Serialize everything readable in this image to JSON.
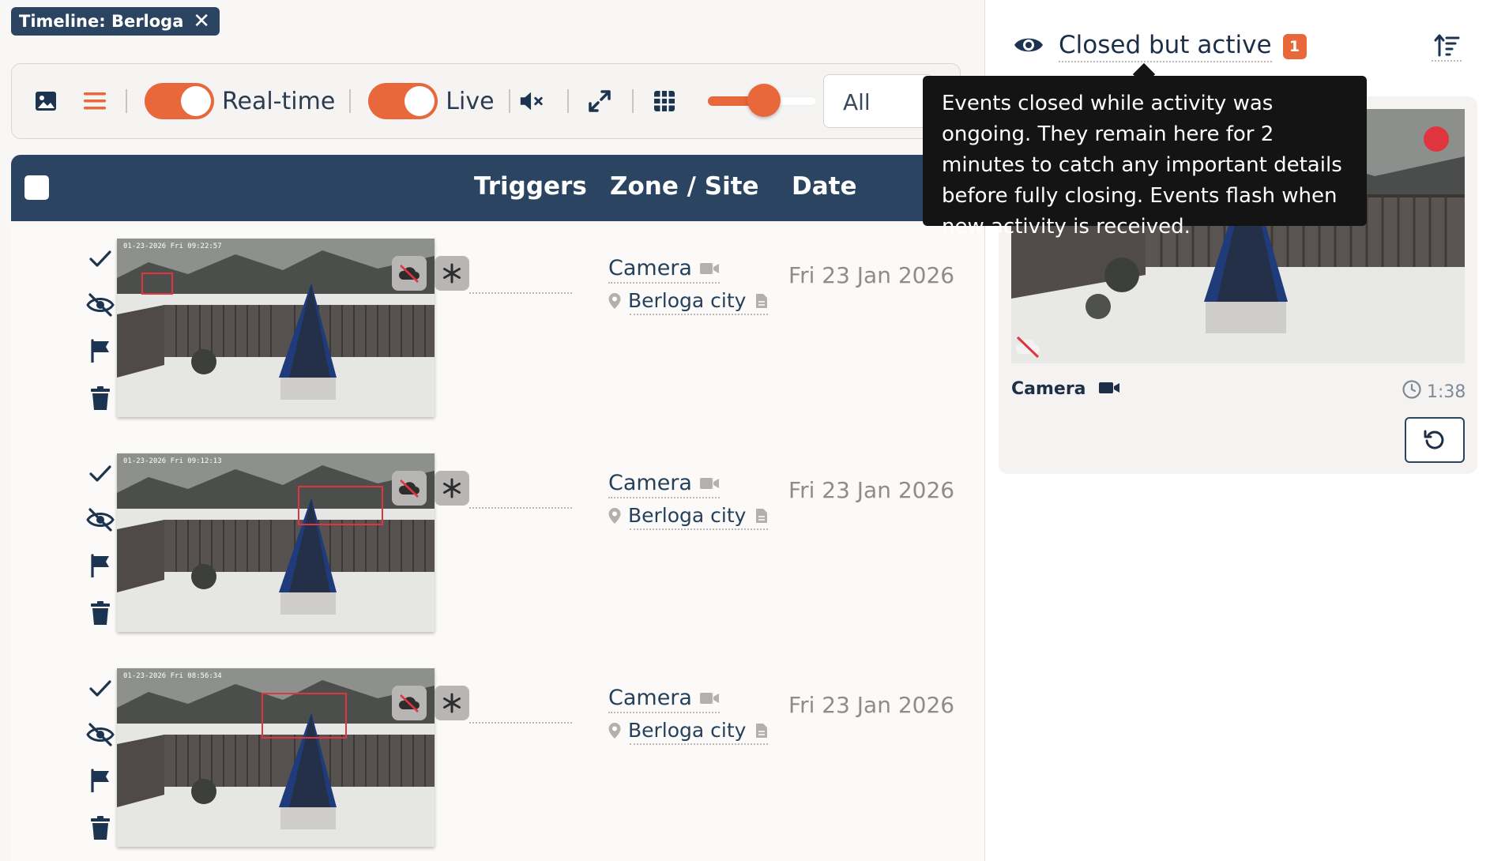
{
  "tab": {
    "title": "Timeline: Berloga",
    "close": "✕"
  },
  "toolbar": {
    "realtime_label": "Real-time",
    "live_label": "Live",
    "filter_value": "All",
    "realtime_on": true,
    "live_on": true,
    "thumb_size_level": 0.45,
    "accent": "#e8673b"
  },
  "table": {
    "columns": [
      "Triggers",
      "Zone / Site",
      "Date"
    ],
    "rows": [
      {
        "camera": "Camera",
        "site": "Berloga city",
        "date": "Fri 23 Jan 2026",
        "stamp": "01-23-2026 Fri 09:22:57"
      },
      {
        "camera": "Camera",
        "site": "Berloga city",
        "date": "Fri 23 Jan 2026",
        "stamp": "01-23-2026 Fri 09:12:13"
      },
      {
        "camera": "Camera",
        "site": "Berloga city",
        "date": "Fri 23 Jan 2026",
        "stamp": "01-23-2026 Fri 08:56:34"
      }
    ]
  },
  "panel": {
    "title": "Closed but active",
    "count": "1",
    "card": {
      "camera": "Camera",
      "time": "1:38"
    }
  },
  "tooltip": {
    "text": "Events closed while activity was ongoing. They remain here for 2 minutes to catch any important details before fully closing. Events flash when new activity is received."
  },
  "colors": {
    "header": "#2b4461",
    "recording": "#e0353f"
  }
}
